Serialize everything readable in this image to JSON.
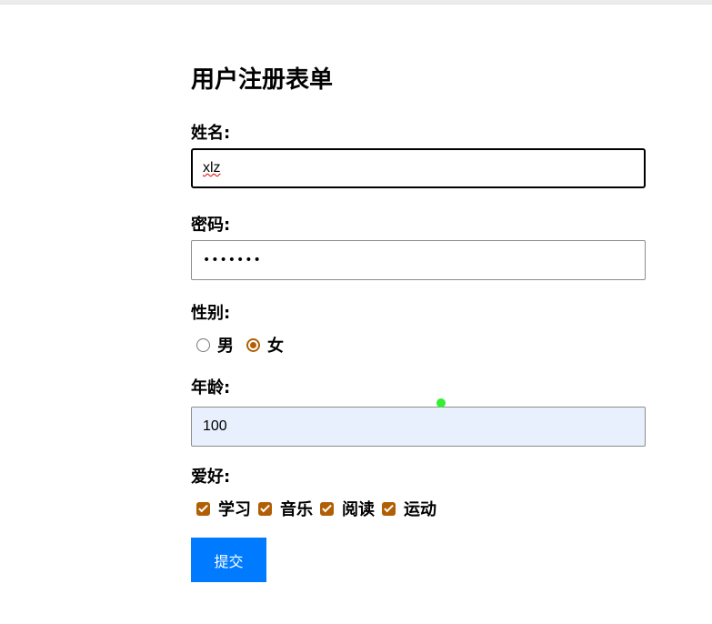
{
  "form": {
    "title": "用户注册表单",
    "name": {
      "label": "姓名:",
      "value": "xlz"
    },
    "password": {
      "label": "密码:",
      "value": "•••••••"
    },
    "gender": {
      "label": "性别:",
      "options": [
        {
          "label": "男",
          "checked": false
        },
        {
          "label": "女",
          "checked": true
        }
      ]
    },
    "age": {
      "label": "年龄:",
      "value": "100"
    },
    "hobbies": {
      "label": "爱好:",
      "options": [
        {
          "label": "学习",
          "checked": true
        },
        {
          "label": "音乐",
          "checked": true
        },
        {
          "label": "阅读",
          "checked": true
        },
        {
          "label": "运动",
          "checked": true
        }
      ]
    },
    "submit_label": "提交"
  },
  "colors": {
    "accent": "#b15f05",
    "button": "#007bff",
    "autofill_bg": "#e8f0fe",
    "cursor": "#33ee33"
  }
}
